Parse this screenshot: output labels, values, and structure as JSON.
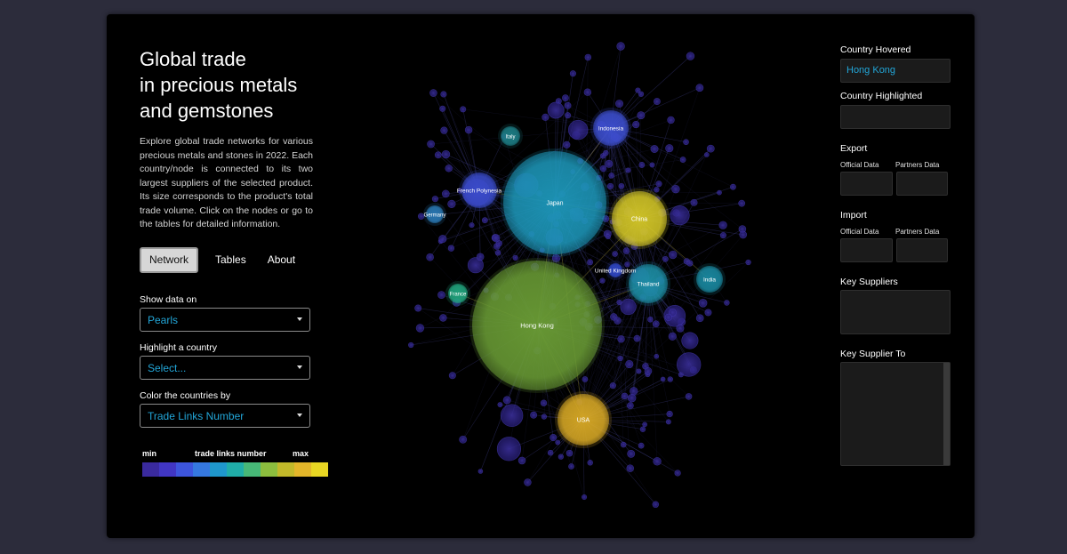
{
  "app": {
    "title_lines": [
      "Global trade",
      "in precious metals",
      "and gemstones"
    ],
    "description": "Explore global trade networks for various precious metals and stones in 2022. Each country/node is connected to its two largest suppliers of the selected product. Its size corresponds to the product's total trade volume. Click on the nodes or go to the tables for detailed information."
  },
  "tabs": [
    {
      "label": "Network",
      "active": true
    },
    {
      "label": "Tables",
      "active": false
    },
    {
      "label": "About",
      "active": false
    }
  ],
  "controls": {
    "show_data_label": "Show data on",
    "show_data_value": "Pearls",
    "highlight_label": "Highlight a country",
    "highlight_value": "Select...",
    "color_label": "Color the countries by",
    "color_value": "Trade Links Number"
  },
  "legend": {
    "min": "min",
    "mid": "trade links number",
    "max": "max",
    "colors": [
      "#3a2a9e",
      "#4136c4",
      "#3d55dd",
      "#3578e0",
      "#1f97cc",
      "#20ada8",
      "#47b877",
      "#8cbe3e",
      "#c2b92a",
      "#e3b62a",
      "#e8d623"
    ]
  },
  "network": {
    "nodes": [
      {
        "name": "Japan",
        "color": "#1d96b8"
      },
      {
        "name": "Hong Kong",
        "color": "#6a9c35"
      },
      {
        "name": "China",
        "color": "#d4c727"
      },
      {
        "name": "USA",
        "color": "#d8a925"
      },
      {
        "name": "Indonesia",
        "color": "#3d4fd0"
      },
      {
        "name": "French Polynesia",
        "color": "#3a4ccc"
      },
      {
        "name": "Thailand",
        "color": "#1d8fa6"
      },
      {
        "name": "India",
        "color": "#1a8aa2"
      },
      {
        "name": "Italy",
        "color": "#1d7f87"
      },
      {
        "name": "Germany",
        "color": "#2a7ab7"
      },
      {
        "name": "France",
        "color": "#22a780"
      },
      {
        "name": "United Kingdom",
        "color": "#3048c8"
      }
    ]
  },
  "panel": {
    "hovered_label": "Country Hovered",
    "hovered_value": "Hong Kong",
    "highlighted_label": "Country Highlighted",
    "highlighted_value": "",
    "export_label": "Export",
    "import_label": "Import",
    "official_label": "Official Data",
    "partners_label": "Partners Data",
    "key_suppliers_label": "Key Suppliers",
    "key_supplier_to_label": "Key Supplier To"
  }
}
